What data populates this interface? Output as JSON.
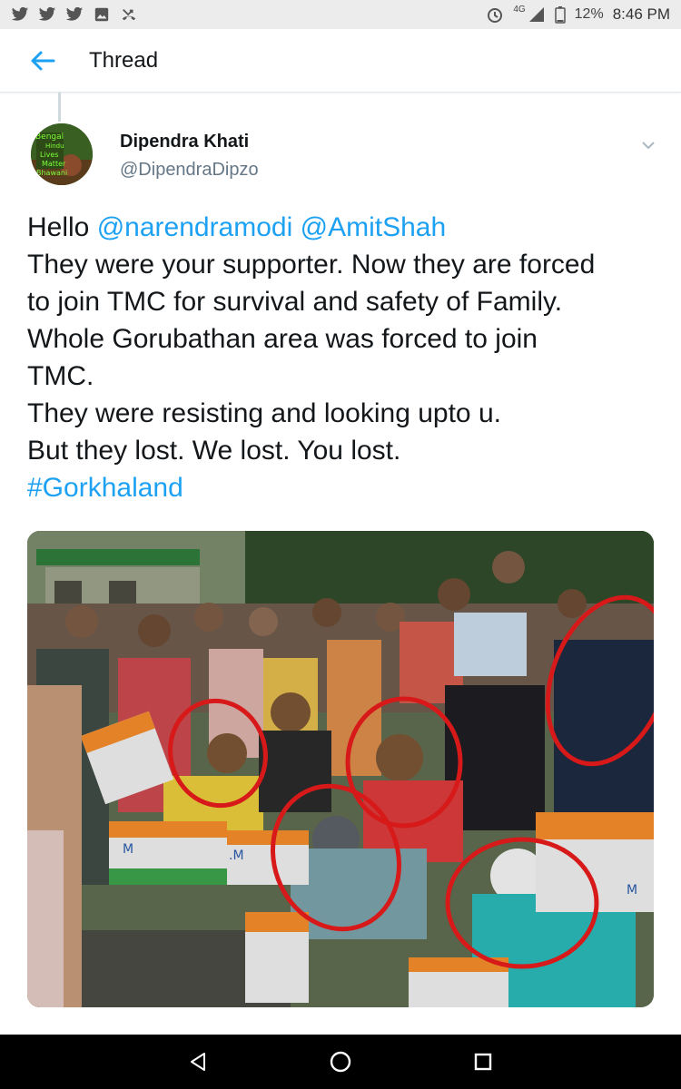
{
  "status_bar": {
    "left_icons": [
      "twitter-icon",
      "twitter-icon",
      "twitter-icon",
      "image-icon",
      "missed-call-icon"
    ],
    "network": "4G",
    "battery": "12%",
    "time": "8:46 PM"
  },
  "app_bar": {
    "title": "Thread"
  },
  "tweet": {
    "author_name": "Dipendra Khati",
    "author_handle": "@DipendraDipzo",
    "avatar_text": [
      "Bengal",
      "Hindu",
      "Lives",
      "Matter",
      "Bhawani"
    ],
    "text": {
      "line1_prefix": "Hello ",
      "mention1": "@narendramodi",
      "mention2": "@AmitShah",
      "line2": "They were your supporter. Now they are forced",
      "line3": "to join TMC for survival and safety of Family.",
      "line4": "Whole Gorubathan area was forced to join",
      "line5": "TMC.",
      "line6": "They were resisting and looking upto u.",
      "line7": "But they lost. We lost. You lost.",
      "hashtag": "#Gorkhaland"
    },
    "photo_flags": [
      "M",
      "M",
      ".M",
      "M"
    ]
  },
  "colors": {
    "link": "#1da1f2",
    "handle": "#657786",
    "circle": "#e31b1b"
  }
}
